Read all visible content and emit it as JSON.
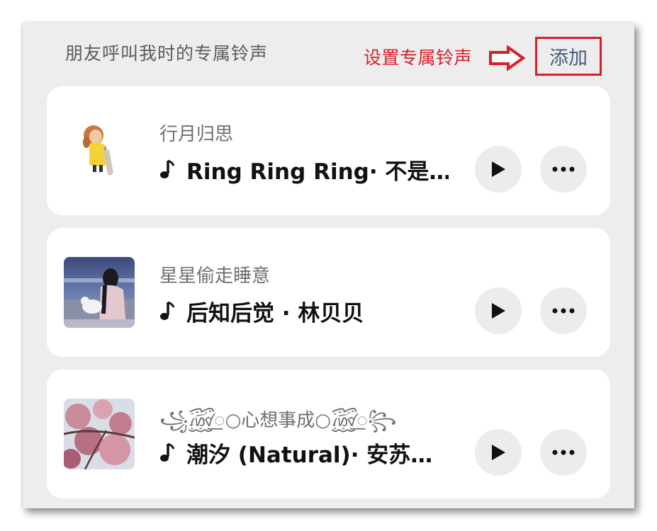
{
  "header": {
    "title": "朋友呼叫我时的专属铃声",
    "annotation": "设置专属铃声",
    "add_label": "添加"
  },
  "colors": {
    "accent_red": "#d8202a",
    "add_text": "#4a5a7e",
    "background": "#ededed",
    "card": "#ffffff"
  },
  "ringtones": [
    {
      "contact": "行月归思",
      "song": "Ring Ring Ring· 不是…",
      "thumbnail_icon": "cartoon-girl-umbrella-icon"
    },
    {
      "contact": "星星偷走睡意",
      "song": "后知后觉 · 林贝贝",
      "thumbnail_icon": "girl-with-cat-photo"
    },
    {
      "contact": "꧁꫞꯭○心想事成○꫞꯭꧂",
      "song": "潮汐 (Natural)· 安苏…",
      "thumbnail_icon": "cherry-blossom-photo"
    }
  ]
}
